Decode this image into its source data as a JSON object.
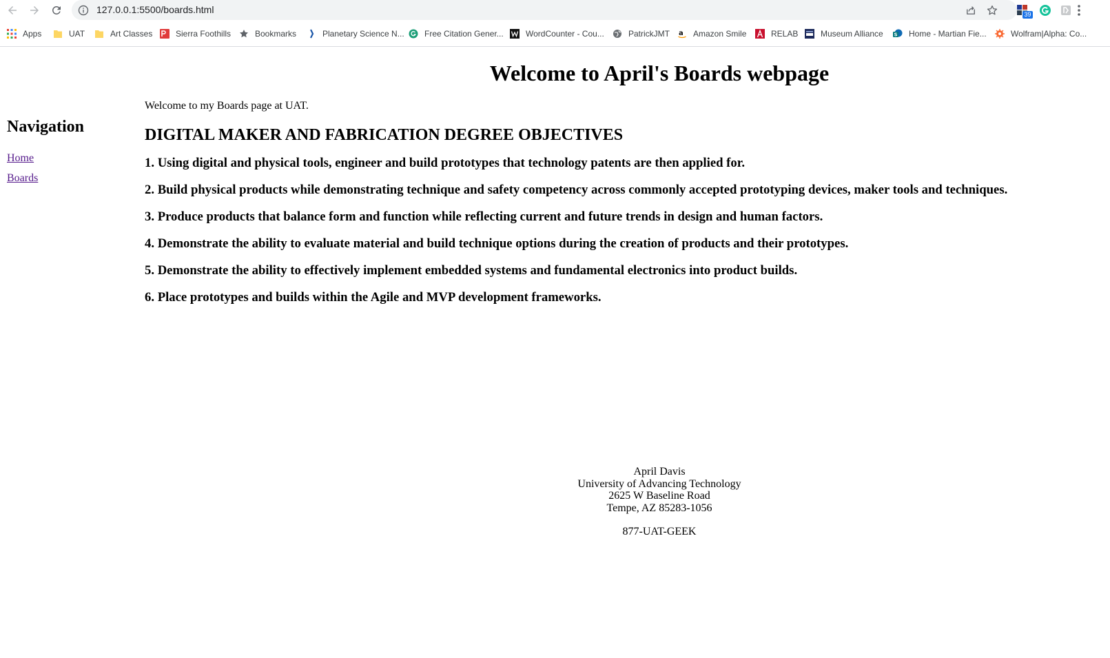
{
  "browser": {
    "url": "127.0.0.1:5500/boards.html",
    "extension_badge": "39",
    "bookmarks": [
      {
        "label": "Apps",
        "icon": "apps-grid-icon"
      },
      {
        "label": "UAT",
        "icon": "folder-icon"
      },
      {
        "label": "Art Classes",
        "icon": "folder-icon"
      },
      {
        "label": "Sierra Foothills",
        "icon": "sierra-foothills-icon"
      },
      {
        "label": "Bookmarks",
        "icon": "star-icon"
      },
      {
        "label": "Planetary Science N...",
        "icon": "planetary-science-icon"
      },
      {
        "label": "Free Citation Gener...",
        "icon": "citation-icon"
      },
      {
        "label": "WordCounter - Cou...",
        "icon": "wordcounter-icon"
      },
      {
        "label": "PatrickJMT",
        "icon": "globe-icon"
      },
      {
        "label": "Amazon Smile",
        "icon": "amazon-icon"
      },
      {
        "label": "RELAB",
        "icon": "relab-icon"
      },
      {
        "label": "Museum Alliance",
        "icon": "museum-alliance-icon"
      },
      {
        "label": "Home - Martian Fie...",
        "icon": "sharepoint-icon"
      },
      {
        "label": "Wolfram|Alpha: Co...",
        "icon": "wolfram-icon"
      }
    ]
  },
  "page": {
    "title": "Welcome to April's Boards webpage",
    "sidebar": {
      "heading": "Navigation",
      "links": [
        "Home",
        "Boards"
      ]
    },
    "intro": "Welcome to my Boards page at UAT.",
    "section_heading": "DIGITAL MAKER AND FABRICATION DEGREE OBJECTIVES",
    "objectives": [
      "1. Using digital and physical tools, engineer and build prototypes that technology patents are then applied for.",
      "2. Build physical products while demonstrating technique and safety competency across commonly accepted prototyping devices, maker tools and techniques.",
      "3. Produce products that balance form and function while reflecting current and future trends in design and human factors.",
      "4. Demonstrate the ability to evaluate material and build technique options during the creation of products and their prototypes.",
      "5. Demonstrate the ability to effectively implement embedded systems and fundamental electronics into product builds.",
      "6. Place prototypes and builds within the Agile and MVP development frameworks."
    ],
    "footer": {
      "name": "April Davis",
      "organization": "University of Advancing Technology",
      "street": "2625 W Baseline Road",
      "city": "Tempe, AZ 85283-1056",
      "phone": "877-UAT-GEEK"
    }
  }
}
